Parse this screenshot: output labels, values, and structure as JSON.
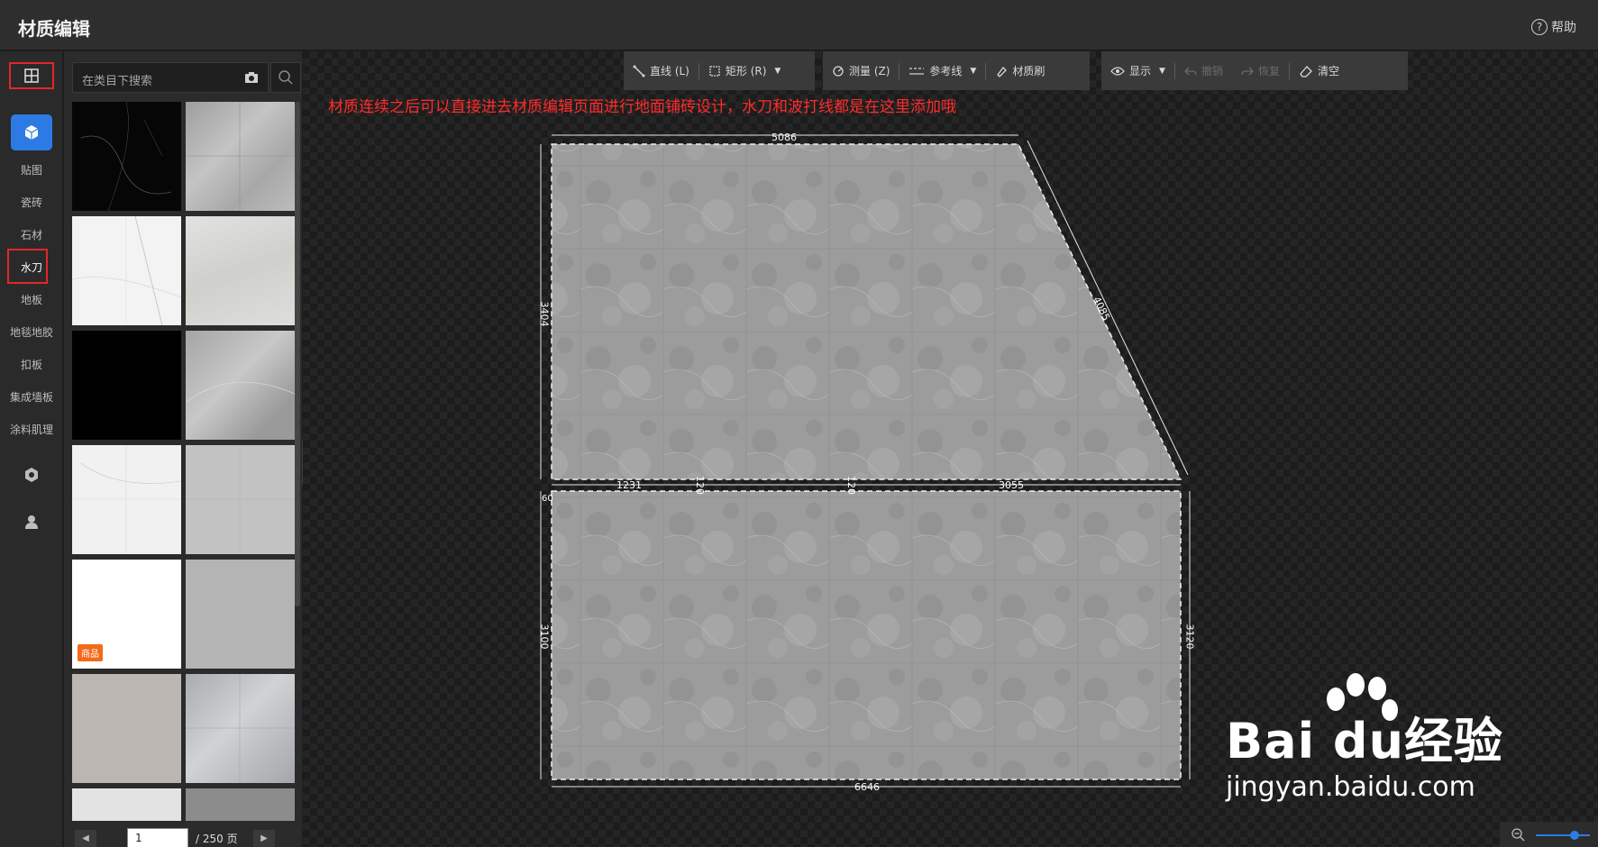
{
  "app": {
    "title": "材质编辑",
    "help_label": "帮助"
  },
  "nav": {
    "items": [
      {
        "label": "贴图"
      },
      {
        "label": "瓷砖"
      },
      {
        "label": "石材"
      },
      {
        "label": "水刀"
      },
      {
        "label": "地板"
      },
      {
        "label": "地毯地胶"
      },
      {
        "label": "扣板"
      },
      {
        "label": "集成墙板"
      },
      {
        "label": "涂料肌理"
      }
    ]
  },
  "panel": {
    "search_placeholder": "在类目下搜索",
    "badge": "商品",
    "pager": {
      "current": "1",
      "total": "/ 250 页"
    }
  },
  "toolbar": {
    "line": "直线 (L)",
    "rect": "矩形 (R)",
    "measure": "测量 (Z)",
    "guide": "参考线",
    "brush": "材质刷",
    "display": "显示",
    "undo": "撤销",
    "redo": "恢复",
    "clear": "清空"
  },
  "annotation": "材质连续之后可以直接进去材质编辑页面进行地面铺砖设计，水刀和波打线都是在这里添加哦",
  "dimensions": {
    "top": "5086",
    "right_slant": "4085",
    "left_upper": "3404",
    "left_lower": "3100",
    "right_lower": "3120",
    "bottom": "6646",
    "mid_a": "1231",
    "mid_b": "120",
    "mid_c": "120",
    "mid_d": "3055",
    "mid_e": "60"
  },
  "watermark": {
    "brand": "Bai du经验",
    "url": "jingyan.baidu.com"
  },
  "colors": {
    "accent": "#2c7be5",
    "highlight": "#e3262a",
    "badge": "#f26a1b"
  }
}
